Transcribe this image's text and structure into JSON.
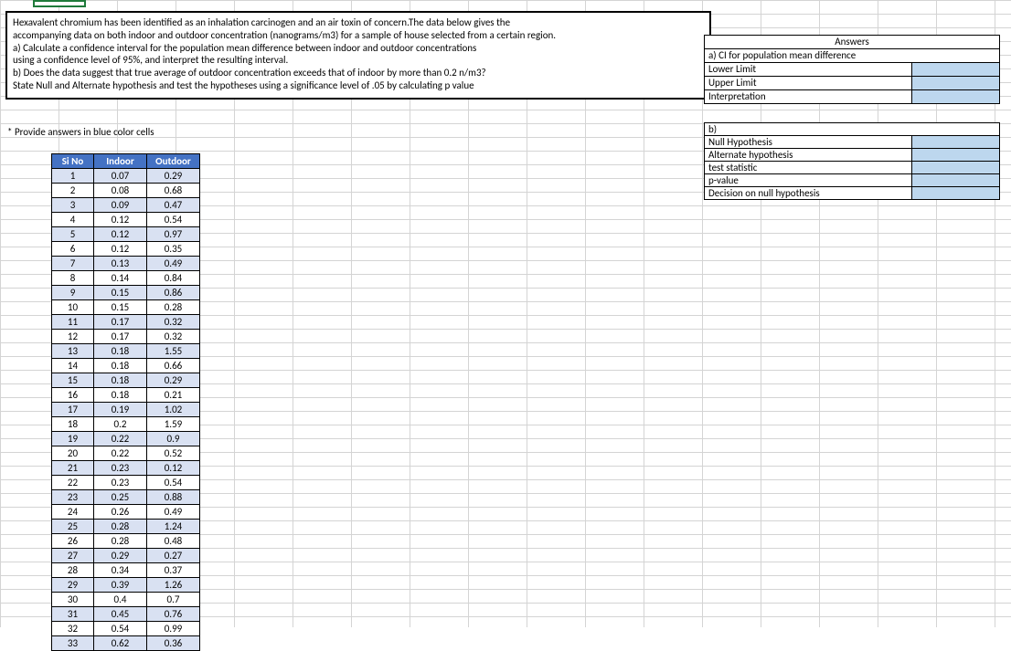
{
  "question": {
    "p1": "Hexavalent chromium has been identified as an inhalation carcinogen and an air toxin of concern.The data below gives the",
    "p2": "accompanying data on both indoor and outdoor concentration (nanograms/m3) for a sample of house selected from a certain region.",
    "p3": "a) Calculate a confidence interval for the population mean difference between indoor and outdoor concentrations",
    "p4": "using a confidence level of 95%, and interpret the resulting interval.",
    "p5": "b) Does the data suggest that true average of outdoor concentration exceeds that of indoor by more than 0.2 n/m3?",
    "p6": "State Null and Alternate hypothesis and test the hypotheses using a significance level of .05 by calculating p value"
  },
  "note": "* Provide answers in blue color cells",
  "headers": {
    "si": "Si No",
    "indoor": "Indoor",
    "outdoor": "Outdoor"
  },
  "rows": [
    {
      "si": "1",
      "in": "0.07",
      "out": "0.29"
    },
    {
      "si": "2",
      "in": "0.08",
      "out": "0.68"
    },
    {
      "si": "3",
      "in": "0.09",
      "out": "0.47"
    },
    {
      "si": "4",
      "in": "0.12",
      "out": "0.54"
    },
    {
      "si": "5",
      "in": "0.12",
      "out": "0.97"
    },
    {
      "si": "6",
      "in": "0.12",
      "out": "0.35"
    },
    {
      "si": "7",
      "in": "0.13",
      "out": "0.49"
    },
    {
      "si": "8",
      "in": "0.14",
      "out": "0.84"
    },
    {
      "si": "9",
      "in": "0.15",
      "out": "0.86"
    },
    {
      "si": "10",
      "in": "0.15",
      "out": "0.28"
    },
    {
      "si": "11",
      "in": "0.17",
      "out": "0.32"
    },
    {
      "si": "12",
      "in": "0.17",
      "out": "0.32"
    },
    {
      "si": "13",
      "in": "0.18",
      "out": "1.55"
    },
    {
      "si": "14",
      "in": "0.18",
      "out": "0.66"
    },
    {
      "si": "15",
      "in": "0.18",
      "out": "0.29"
    },
    {
      "si": "16",
      "in": "0.18",
      "out": "0.21"
    },
    {
      "si": "17",
      "in": "0.19",
      "out": "1.02"
    },
    {
      "si": "18",
      "in": "0.2",
      "out": "1.59"
    },
    {
      "si": "19",
      "in": "0.22",
      "out": "0.9"
    },
    {
      "si": "20",
      "in": "0.22",
      "out": "0.52"
    },
    {
      "si": "21",
      "in": "0.23",
      "out": "0.12"
    },
    {
      "si": "22",
      "in": "0.23",
      "out": "0.54"
    },
    {
      "si": "23",
      "in": "0.25",
      "out": "0.88"
    },
    {
      "si": "24",
      "in": "0.26",
      "out": "0.49"
    },
    {
      "si": "25",
      "in": "0.28",
      "out": "1.24"
    },
    {
      "si": "26",
      "in": "0.28",
      "out": "0.48"
    },
    {
      "si": "27",
      "in": "0.29",
      "out": "0.27"
    },
    {
      "si": "28",
      "in": "0.34",
      "out": "0.37"
    },
    {
      "si": "29",
      "in": "0.39",
      "out": "1.26"
    },
    {
      "si": "30",
      "in": "0.4",
      "out": "0.7"
    },
    {
      "si": "31",
      "in": "0.45",
      "out": "0.76"
    },
    {
      "si": "32",
      "in": "0.54",
      "out": "0.99"
    },
    {
      "si": "33",
      "in": "0.62",
      "out": "0.36"
    }
  ],
  "answers": {
    "title": "Answers",
    "a_label": "a) CI for population mean difference",
    "lower": "Lower Limit",
    "upper": "Upper Limit",
    "interp": "Interpretation",
    "b_label": "b)",
    "null_h": "Null Hypothesis",
    "alt_h": "Alternate hypothesis",
    "tstat": "test statistic",
    "pval": "p-value",
    "decision": "Decision on null hypothesis"
  }
}
